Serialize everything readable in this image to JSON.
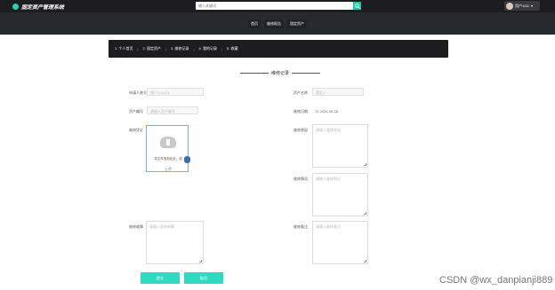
{
  "header": {
    "app_title": "固定资产管理系统",
    "search_placeholder": "输入关键词",
    "user_name": "用户1111",
    "user_caret": "▾"
  },
  "nav": {
    "items": [
      {
        "label": "首页"
      },
      {
        "label": "维修报告"
      },
      {
        "label": "固定资产"
      }
    ]
  },
  "steps": {
    "items": [
      {
        "label": "1. 个人首页"
      },
      {
        "label": "2. 固定资产"
      },
      {
        "label": "3. 维修记录"
      },
      {
        "label": "4. 我的记录"
      },
      {
        "label": "5. 收藏"
      }
    ]
  },
  "form": {
    "title": "维修记录",
    "left": {
      "applicant_label": "申请人账号",
      "applicant_value": "账户1111111",
      "asset_code_label": "资产编号",
      "asset_code_placeholder": "请输入资产编号",
      "proof_label": "维修凭证",
      "upload_tip": "将文件拖到此处，或",
      "upload_link": "上传",
      "fault_label": "维修故障",
      "fault_placeholder": "请输入维修故障"
    },
    "right": {
      "asset_name_label": "资产名称",
      "asset_name_value": "固定1",
      "date_label": "维修日期",
      "date_value": "2024-05-05",
      "date_icon_text": "⊡",
      "remark1_label": "维修原因",
      "remark1_placeholder": "请输入维修原因",
      "remark2_label": "维修情况",
      "remark2_placeholder": "请输入维修情况",
      "remark3_label": "维修备注",
      "remark3_placeholder": "请输入维修备注"
    },
    "submit_label": "提交",
    "cancel_label": "取消"
  },
  "watermark": "CSDN @wx_danpianji889",
  "colors": {
    "accent": "#2fd9c2",
    "topbar": "#1d1d1f",
    "navbar": "#26292d"
  }
}
